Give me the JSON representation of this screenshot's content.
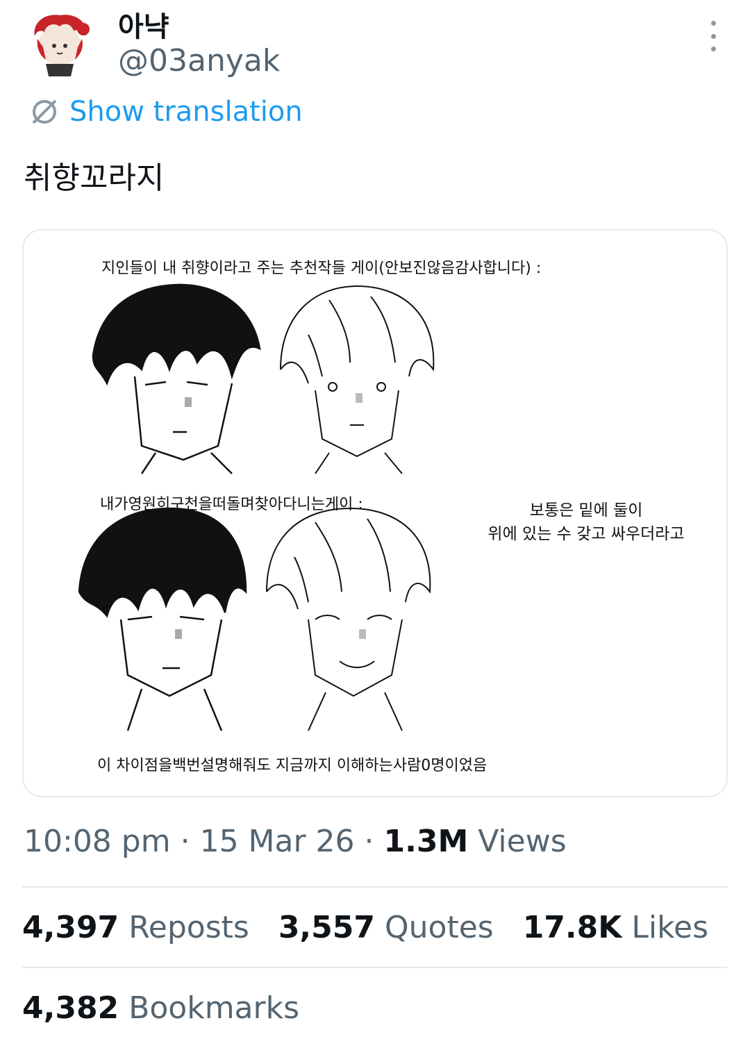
{
  "author": {
    "display_name": "아냑",
    "handle": "@03anyak"
  },
  "actions": {
    "show_translation": "Show translation"
  },
  "tweet": {
    "text": "취향꼬라지"
  },
  "media": {
    "caption_top": "지인들이 내 취향이라고 주는 추천작들 게이(안보진않음감사합니다) :",
    "caption_middle": "내가영원히구천을떠돌며찾아다니는게이 :",
    "caption_bottom": "이 차이점을백번설명해줘도 지금까지 이해하는사람0명이었음",
    "side_note_line1": "보통은 밑에 둘이",
    "side_note_line2": "위에 있는 수 갖고 싸우더라고"
  },
  "meta": {
    "time": "10:08 pm",
    "date": "15 Mar 26",
    "views_count": "1.3M",
    "views_label": "Views",
    "separator": "·"
  },
  "stats": {
    "reposts_count": "4,397",
    "reposts_label": "Reposts",
    "quotes_count": "3,557",
    "quotes_label": "Quotes",
    "likes_count": "17.8K",
    "likes_label": "Likes",
    "bookmarks_count": "4,382",
    "bookmarks_label": "Bookmarks"
  },
  "colors": {
    "link": "#1d9bf0",
    "secondary_text": "#536471",
    "primary_text": "#0f1419",
    "border": "#e7e9eb"
  }
}
